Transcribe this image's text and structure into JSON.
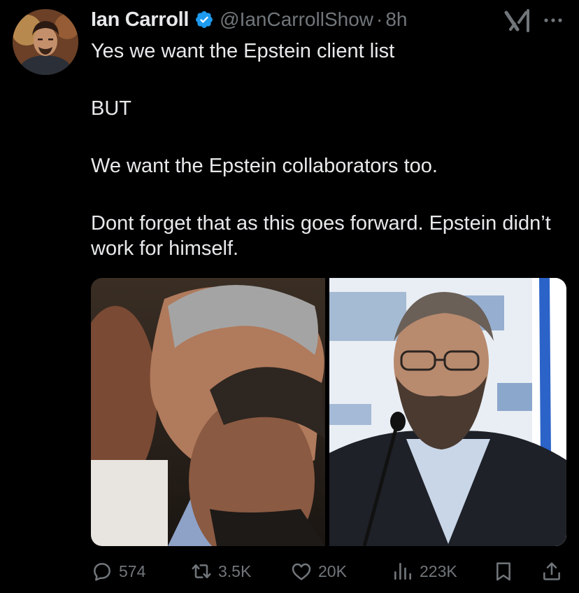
{
  "author": {
    "display_name": "Ian Carroll",
    "handle": "@IanCarrollShow",
    "separator": "·",
    "time": "8h",
    "verified": true
  },
  "tweet": {
    "lines": [
      "Yes we want the Epstein client list",
      "BUT",
      "We want the Epstein collaborators too.",
      "Dont forget that as this goes forward. Epstein didn’t work for himself."
    ]
  },
  "media": {
    "count": 2
  },
  "actions": {
    "replies": "574",
    "reposts": "3.5K",
    "likes": "20K",
    "views": "223K"
  },
  "colors": {
    "background": "#000000",
    "text": "#e7e9ea",
    "secondary": "#71767b",
    "verified": "#1d9bf0"
  },
  "icons": [
    "verified-badge-icon",
    "grok-icon",
    "more-icon",
    "reply-icon",
    "repost-icon",
    "like-icon",
    "views-icon",
    "bookmark-icon",
    "share-icon"
  ]
}
